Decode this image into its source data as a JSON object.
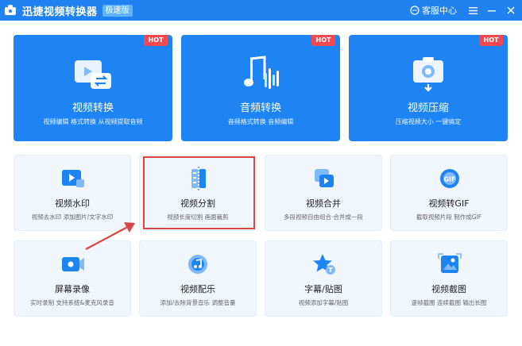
{
  "titlebar": {
    "app_title": "迅捷视频转换器",
    "edition_badge": "极速版",
    "support_label": "客服中心"
  },
  "badge_hot": "HOT",
  "big_cards": [
    {
      "title": "视频转换",
      "desc": "视频编辑 格式转换 从视频提取音频",
      "icon": "video-convert-icon"
    },
    {
      "title": "音频转换",
      "desc": "音频格式转换 音频编辑",
      "icon": "audio-convert-icon"
    },
    {
      "title": "视频压缩",
      "desc": "压缩视频大小 一键搞定",
      "icon": "video-compress-icon"
    }
  ],
  "small_cards": [
    {
      "title": "视频水印",
      "desc": "视频去水印 添加图片/文字水印",
      "icon": "watermark-icon"
    },
    {
      "title": "视频分割",
      "desc": "视频长度切割 画面裁剪",
      "icon": "split-icon"
    },
    {
      "title": "视频合并",
      "desc": "多段视频自由组合·合并成一段",
      "icon": "merge-icon"
    },
    {
      "title": "视频转GIF",
      "desc": "截取视频片段 制作成GIF",
      "icon": "gif-icon"
    },
    {
      "title": "屏幕录像",
      "desc": "实时录制 支持系统&麦克风录音",
      "icon": "screen-record-icon"
    },
    {
      "title": "视频配乐",
      "desc": "添加/去除背景音乐 调整音量",
      "icon": "music-icon"
    },
    {
      "title": "字幕/贴图",
      "desc": "视频添加字幕/贴图",
      "icon": "subtitle-icon"
    },
    {
      "title": "视频截图",
      "desc": "逐帧截图 连续截图 输出长图",
      "icon": "screenshot-icon"
    }
  ],
  "colors": {
    "titlebar": "#1f82f0",
    "card_primary": "#1f84f3",
    "hot_badge": "#f0494f",
    "small_card_bg": "#f1f6fd",
    "annotation_red": "#d94545"
  }
}
